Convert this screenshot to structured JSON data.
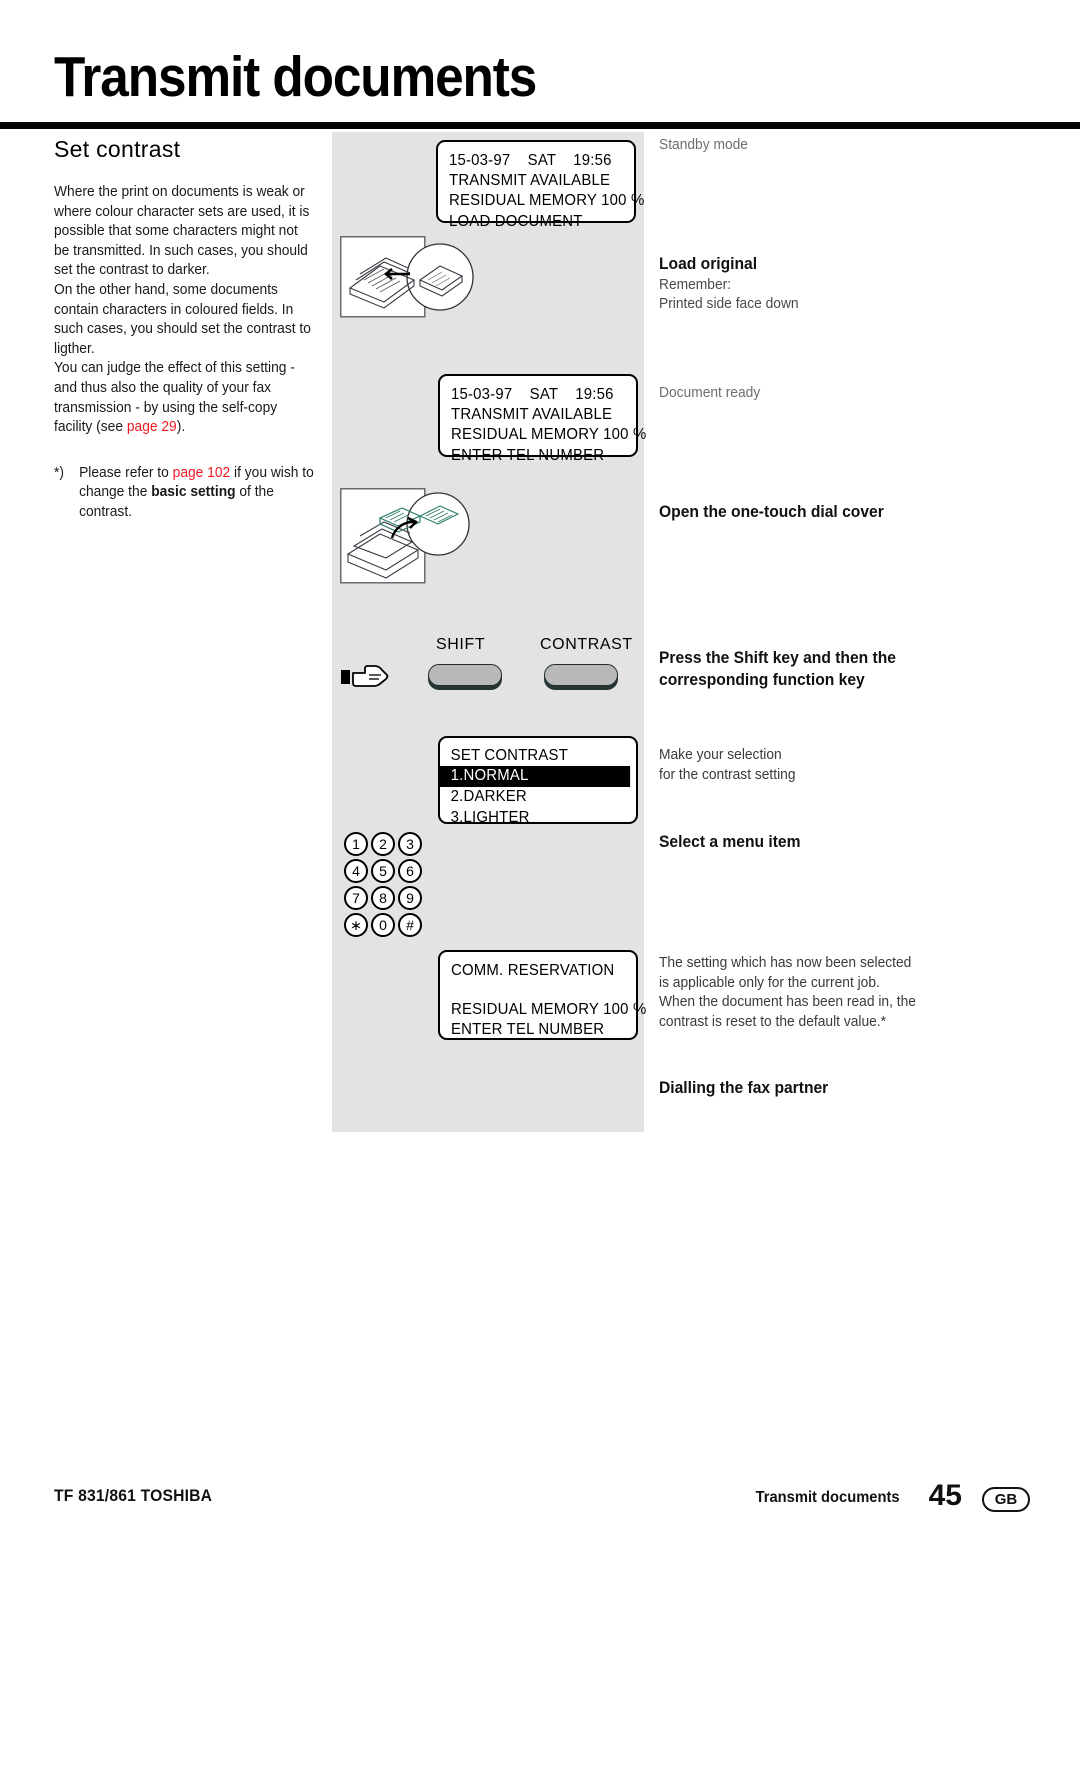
{
  "header": {
    "title": "Transmit documents"
  },
  "left_column": {
    "section_title": "Set contrast",
    "paragraph_1": "Where the print on documents is weak or where colour character sets are used, it is possible that some characters might not be transmitted. In such cases, you should set the contrast to darker.",
    "paragraph_2": "On the other hand, some documents contain characters in coloured fields. In such cases, you should set the contrast to ligther.",
    "paragraph_3_pre": "You can judge the effect of this setting - and thus also the quality of your fax transmission - by using the self-copy facility (see ",
    "paragraph_3_link": "page 29",
    "paragraph_3_post": ").",
    "footnote_mark": "*)",
    "footnote_pre": "Please refer to ",
    "footnote_link": "page 102",
    "footnote_mid": " if you wish to change the ",
    "footnote_bold": "basic setting",
    "footnote_post": " of the contrast."
  },
  "center_panel": {
    "lcd_standby": {
      "line1": "15-03-97    SAT    19:56",
      "line2": "TRANSMIT AVAILABLE",
      "line3": "RESIDUAL MEMORY 100 %",
      "line4": "LOAD DOCUMENT"
    },
    "lcd_ready": {
      "line1": "15-03-97    SAT    19:56",
      "line2": "TRANSMIT AVAILABLE",
      "line3": "RESIDUAL MEMORY 100 %",
      "line4": "ENTER TEL NUMBER"
    },
    "lcd_contrast": {
      "line1": "SET CONTRAST",
      "line2": "1.NORMAL",
      "line3": "2.DARKER",
      "line4": "3.LIGHTER"
    },
    "lcd_comm": {
      "line1": "COMM. RESERVATION",
      "line2": "RESIDUAL MEMORY 100 %",
      "line3": "ENTER TEL NUMBER"
    },
    "keys": {
      "shift_label": "SHIFT",
      "contrast_label": "CONTRAST"
    },
    "keypad": [
      [
        "1",
        "2",
        "3"
      ],
      [
        "4",
        "5",
        "6"
      ],
      [
        "7",
        "8",
        "9"
      ],
      [
        "∗",
        "0",
        "#"
      ]
    ],
    "illustrations": {
      "load_original": "document-feeder-illustration",
      "open_cover": "one-touch-dial-cover-illustration",
      "pointer": "pointing-hand-icon"
    }
  },
  "right_column": {
    "step_standby": "Standby mode",
    "step_load_heading": "Load original",
    "step_load_sub1": "Remember:",
    "step_load_sub2": "Printed side face down",
    "step_doc_ready": "Document ready",
    "step_open_cover": "Open the one-touch dial cover",
    "step_press_shift": "Press the Shift key and then the corresponding function key",
    "step_selection_1": "Make your selection",
    "step_selection_2": "for the contrast setting",
    "step_select_menu": "Select a menu item",
    "step_reservation_note": "The setting which has now been selected is applicable only for the current job. When the document has been read in, the contrast is reset to the default value.*",
    "step_dialling": "Dialling the fax partner"
  },
  "footer": {
    "left": "TF 831/861 TOSHIBA",
    "section": "Transmit documents",
    "page_number": "45",
    "locale": "GB"
  },
  "colors": {
    "accent_red": "#ee1b24",
    "panel_gray": "#e3e3e3",
    "key_gray": "#b9b9b9",
    "caption_gray": "#6e6e6e"
  }
}
